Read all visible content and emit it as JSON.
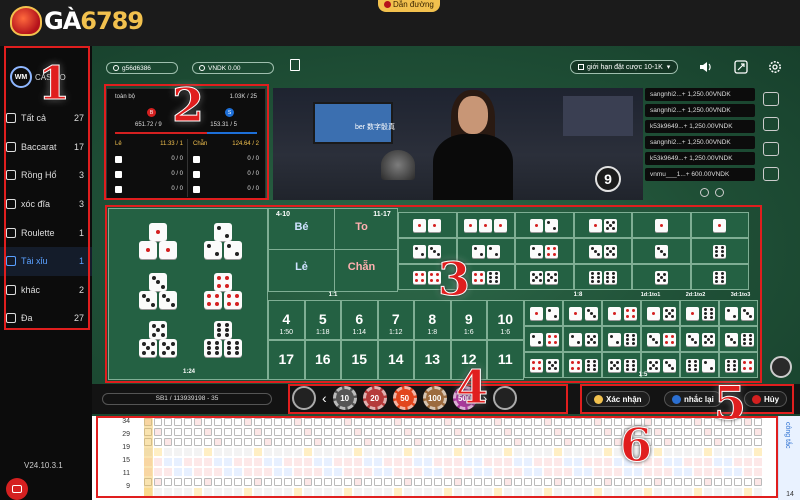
{
  "brand": {
    "name": "GÀ",
    "number": "6789"
  },
  "guide_label": "Dẫn đường",
  "sidebar": {
    "provider": "WM",
    "items": [
      {
        "label": "Tất cả",
        "count": "27",
        "active": false
      },
      {
        "label": "Baccarat",
        "count": "17",
        "active": false
      },
      {
        "label": "Rồng Hổ",
        "count": "3",
        "active": false
      },
      {
        "label": "xóc đĩa",
        "count": "3",
        "active": false
      },
      {
        "label": "Roulette",
        "count": "1",
        "active": false
      },
      {
        "label": "Tài xỉu",
        "count": "1",
        "active": true
      },
      {
        "label": "khác",
        "count": "2",
        "active": false
      },
      {
        "label": "Đa",
        "count": "27",
        "active": false
      }
    ],
    "version": "V24.10.3.1"
  },
  "header": {
    "username": "g56d6386",
    "balance": "VNDK 0.00",
    "bet_limit": "giới hạn đặt cược 10-1K"
  },
  "stats": {
    "all_label": "toàn bộ",
    "all_value": "1.03K / 25",
    "big_label": "B",
    "small_label": "S",
    "big_value": "651.72 / 9",
    "small_value": "153.31 / 5",
    "odd_label": "Lẻ",
    "odd_value": "11.33 / 1",
    "even_label": "Chẵn",
    "even_value": "124.64 / 2",
    "rows_left": [
      "0 / 0",
      "0 / 0",
      "0 / 0"
    ],
    "rows_right": [
      "0 / 0",
      "0 / 0",
      "0 / 0"
    ]
  },
  "video": {
    "title": "ber 数字骰真",
    "timer": "9"
  },
  "bets_feed": [
    "sangnhi2...+ 1,250.00VNDK",
    "sangnhi2...+ 1,250.00VNDK",
    "k53k9649...+ 1,250.00VNDK",
    "sangnhi2...+ 1,250.00VNDK",
    "k53k9649...+ 1,250.00VNDK",
    "vnmu___1...+ 600.00VNDK"
  ],
  "board": {
    "small_range": "4-10",
    "big_range": "11-17",
    "small_label": "Bé",
    "big_label": "To",
    "odd_label": "Lẻ",
    "even_label": "Chẵn",
    "even_money_odds": "1:1",
    "double_odds": "1:8",
    "triple_odds": "1:24",
    "single_odds": [
      "1d:1to1",
      "2d:1to2",
      "3d:1to3"
    ],
    "sums_top": [
      {
        "num": "4",
        "odds": "1:50"
      },
      {
        "num": "5",
        "odds": "1:18"
      },
      {
        "num": "6",
        "odds": "1:14"
      },
      {
        "num": "7",
        "odds": "1:12"
      },
      {
        "num": "8",
        "odds": "1:8"
      },
      {
        "num": "9",
        "odds": "1:6"
      },
      {
        "num": "10",
        "odds": "1:6"
      }
    ],
    "sums_bottom": [
      {
        "num": "17",
        "odds": "1:50"
      },
      {
        "num": "16",
        "odds": "1:18"
      },
      {
        "num": "15",
        "odds": "1:14"
      },
      {
        "num": "14",
        "odds": "1:12"
      },
      {
        "num": "13",
        "odds": "1:8"
      },
      {
        "num": "12",
        "odds": "1:6"
      },
      {
        "num": "11",
        "odds": "1:6"
      }
    ],
    "combo_odds": "1:5"
  },
  "chipbar": {
    "round": "SB1  /  113939198 - 35",
    "chips": [
      {
        "value": "10",
        "color": "#555555"
      },
      {
        "value": "20",
        "color": "#b53a3a"
      },
      {
        "value": "50",
        "color": "#e2451d"
      },
      {
        "value": "100",
        "color": "#9c6b3e"
      },
      {
        "value": "500",
        "color": "#a8379a"
      }
    ],
    "confirm": "Xác nhận",
    "repeat": "nhắc lại",
    "cancel": "Hủy"
  },
  "roadmap": {
    "totals": [
      "34",
      "29",
      "19",
      "15",
      "11",
      "9"
    ],
    "side_tab": "công tắc",
    "side_count": "14"
  },
  "annotations": [
    "1",
    "2",
    "3",
    "4",
    "5",
    "6"
  ],
  "colors": {
    "accent_red": "#e01e1e",
    "table_green": "#246143",
    "active_blue": "#5aa0ff",
    "gold": "#f2c14e"
  }
}
